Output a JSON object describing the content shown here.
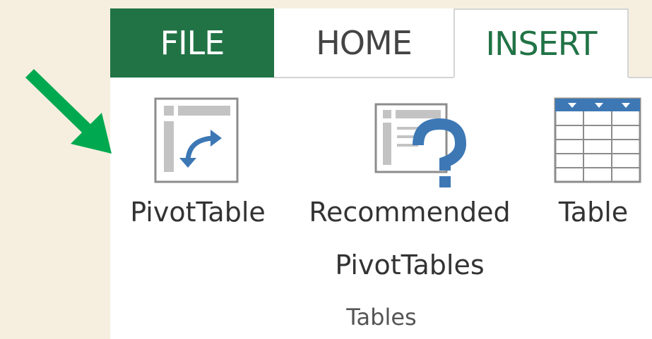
{
  "tabs": [
    {
      "label": "FILE"
    },
    {
      "label": "HOME"
    },
    {
      "label": "INSERT",
      "active": true
    }
  ],
  "group": {
    "label": "Tables",
    "commands": [
      {
        "label": "PivotTable",
        "icon": "pivottable-icon"
      },
      {
        "label_line1": "Recommended",
        "label_line2": "PivotTables",
        "icon": "recommended-pivottables-icon"
      },
      {
        "label": "Table",
        "icon": "table-icon"
      }
    ]
  },
  "annotation": {
    "icon": "green-arrow-icon",
    "color": "#00a94f"
  },
  "colors": {
    "file_tab": "#217346",
    "insert_text": "#217346",
    "accent_blue": "#3d78b5"
  }
}
